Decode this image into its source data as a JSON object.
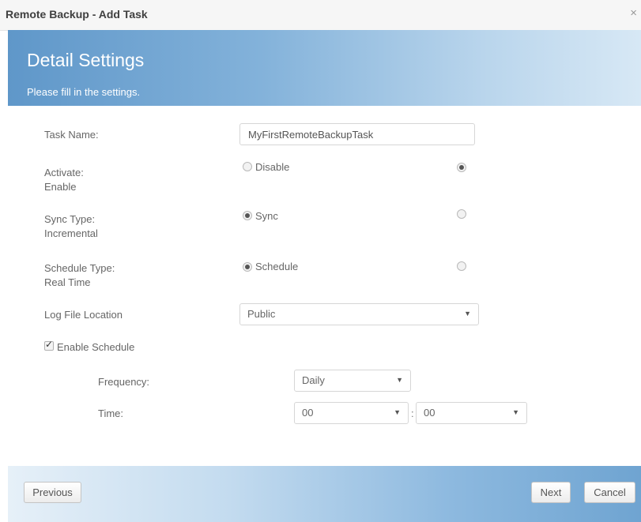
{
  "window": {
    "title": "Remote Backup - Add Task",
    "close_symbol": "×"
  },
  "header": {
    "title": "Detail Settings",
    "subtitle": "Please fill in the settings."
  },
  "form": {
    "task_name": {
      "label": "Task Name:",
      "value": "MyFirstRemoteBackupTask"
    },
    "activate": {
      "label": "Activate:",
      "option_a": "Disable",
      "option_b": "Enable",
      "selected": "Enable"
    },
    "sync_type": {
      "label": "Sync Type:",
      "option_a": "Sync",
      "option_b": "Incremental",
      "selected": "Sync"
    },
    "schedule_type": {
      "label": "Schedule Type:",
      "option_a": "Schedule",
      "option_b": "Real Time",
      "selected": "Schedule"
    },
    "log_file_location": {
      "label": "Log File Location",
      "value": "Public"
    },
    "enable_schedule": {
      "label": "Enable Schedule",
      "checked": true
    },
    "frequency": {
      "label": "Frequency:",
      "value": "Daily"
    },
    "time": {
      "label": "Time:",
      "hour": "00",
      "minute": "00",
      "separator": ":"
    }
  },
  "footer": {
    "previous_label": "Previous",
    "next_label": "Next",
    "cancel_label": "Cancel"
  },
  "icons": {
    "dropdown": "chevron-down-icon",
    "close": "close-icon",
    "check": "check-icon"
  },
  "colors": {
    "header_gradient_start": "#5f97c9",
    "header_gradient_end": "#d7e8f5",
    "footer_gradient_start": "#e6f0f8",
    "footer_gradient_end": "#6fa4d1",
    "text": "#666666"
  }
}
